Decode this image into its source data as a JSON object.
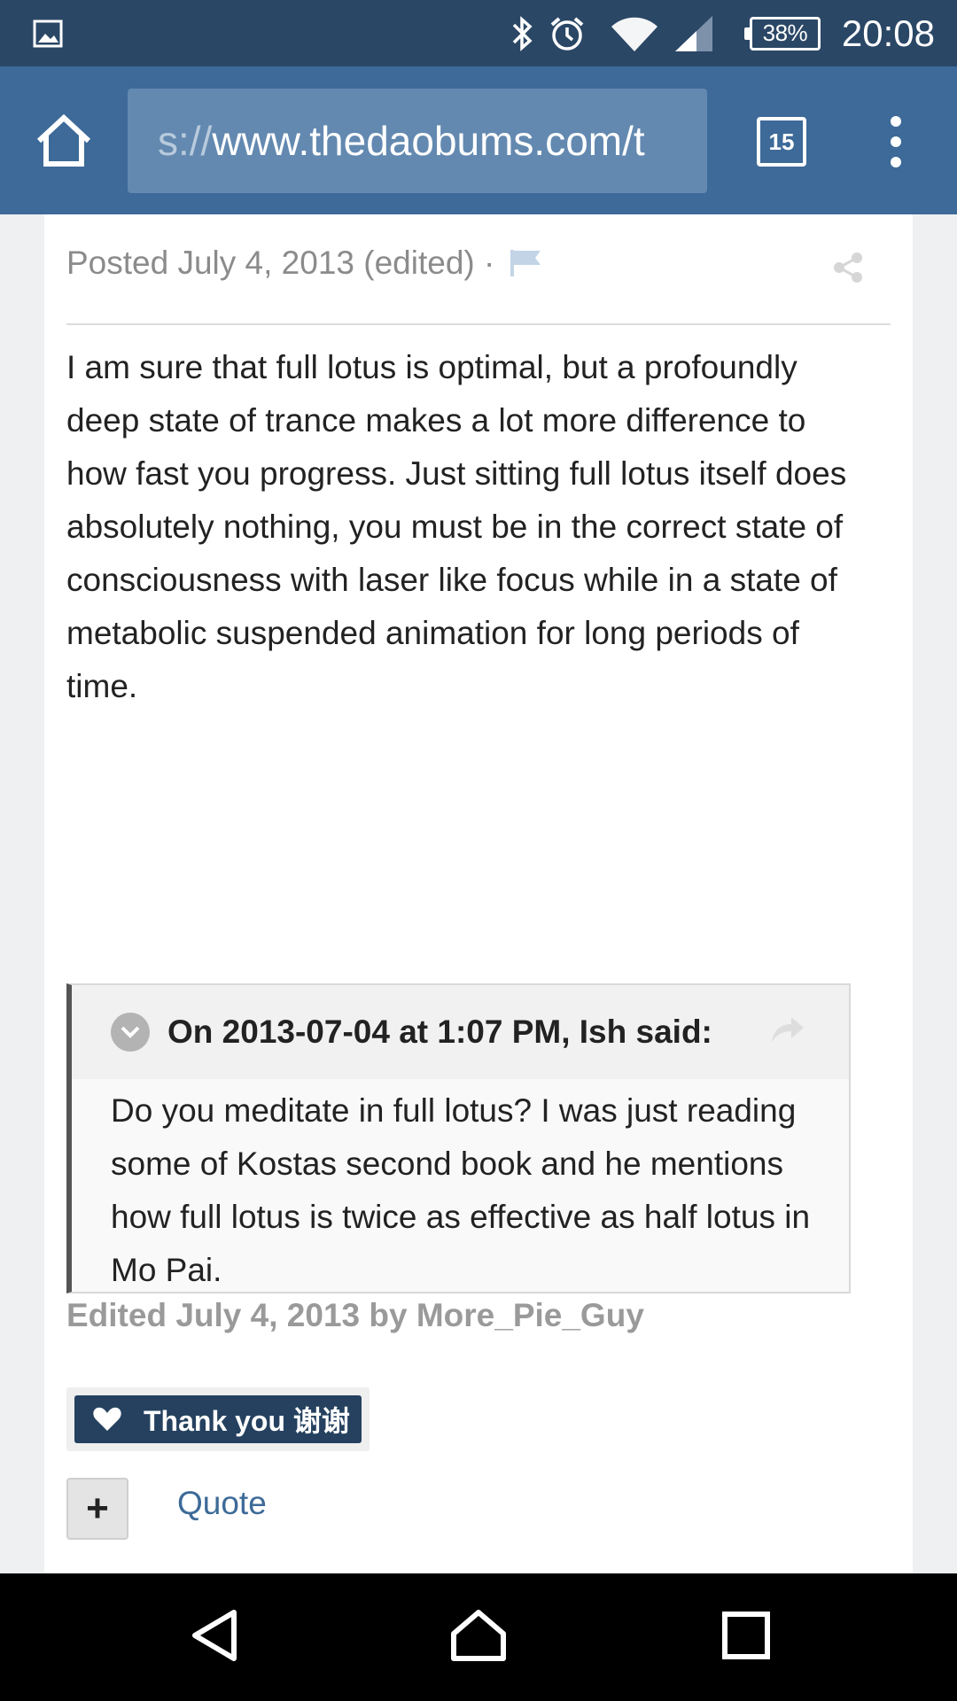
{
  "status_bar": {
    "battery": "38%",
    "time": "20:08",
    "icons": [
      "gallery-icon",
      "bluetooth-icon",
      "alarm-icon",
      "wifi-icon",
      "signal-icon",
      "battery-icon"
    ]
  },
  "browser": {
    "url_scheme": "s://",
    "url_host": "www.thedaobums.com/t",
    "tab_count": "15"
  },
  "post": {
    "meta": "Posted July 4, 2013 (edited) ·",
    "body": "I am sure that full lotus is optimal, but a profoundly deep state of trance makes a lot more difference to how fast you progress. Just sitting full lotus itself does absolutely nothing, you must be in the correct state of consciousness with laser like focus while in a state of metabolic suspended animation for long periods of time.",
    "quote": {
      "citation": "On 2013-07-04 at 1:07 PM, Ish said:",
      "text": "Do you meditate in full lotus? I was just reading some of Kostas second book and he mentions how full lotus is twice as effective as half lotus in Mo Pai."
    },
    "edited_note": "Edited July 4, 2013 by More_Pie_Guy",
    "reaction_label": "Thank you 谢谢",
    "multiquote_label": "+",
    "quote_link": "Quote"
  },
  "colors": {
    "status_bar": "#2b4766",
    "toolbar": "#3d6a98",
    "url_bar": "#6389b0",
    "reaction": "#25415f",
    "link": "#3d6a98"
  }
}
